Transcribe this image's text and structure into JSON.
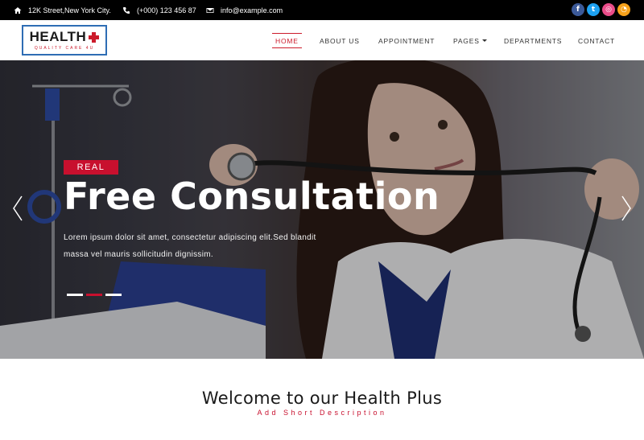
{
  "topbar": {
    "address": "12K Street,New York City.",
    "phone": "(+000) 123 456 87",
    "email": "info@example.com",
    "social": [
      {
        "name": "facebook",
        "glyph": "f",
        "color": "#3b5998"
      },
      {
        "name": "twitter",
        "glyph": "t",
        "color": "#1da1f2"
      },
      {
        "name": "dribbble",
        "glyph": "◎",
        "color": "#ea4c89"
      },
      {
        "name": "rss",
        "glyph": "◔",
        "color": "#f7a21b"
      }
    ]
  },
  "logo": {
    "title": "HEALTH",
    "subtitle": "QUALITY CARE 4U"
  },
  "nav": {
    "items": [
      {
        "label": "HOME",
        "active": true
      },
      {
        "label": "ABOUT US",
        "active": false
      },
      {
        "label": "APPOINTMENT",
        "active": false
      },
      {
        "label": "PAGES",
        "active": false,
        "dropdown": true
      },
      {
        "label": "DEPARTMENTS",
        "active": false
      },
      {
        "label": "CONTACT",
        "active": false
      }
    ]
  },
  "hero": {
    "badge": "REAL",
    "title": "Free Consultation",
    "text": "Lorem ipsum dolor sit amet, consectetur adipiscing elit.Sed blandit massa vel mauris sollicitudin dignissim.",
    "slides_count": 3,
    "active_slide": 2
  },
  "welcome": {
    "title": "Welcome to our Health Plus",
    "subtitle": "Add Short Description"
  },
  "colors": {
    "accent": "#c8102e",
    "logo_border": "#2e6db4",
    "topbar_bg": "#000000"
  }
}
